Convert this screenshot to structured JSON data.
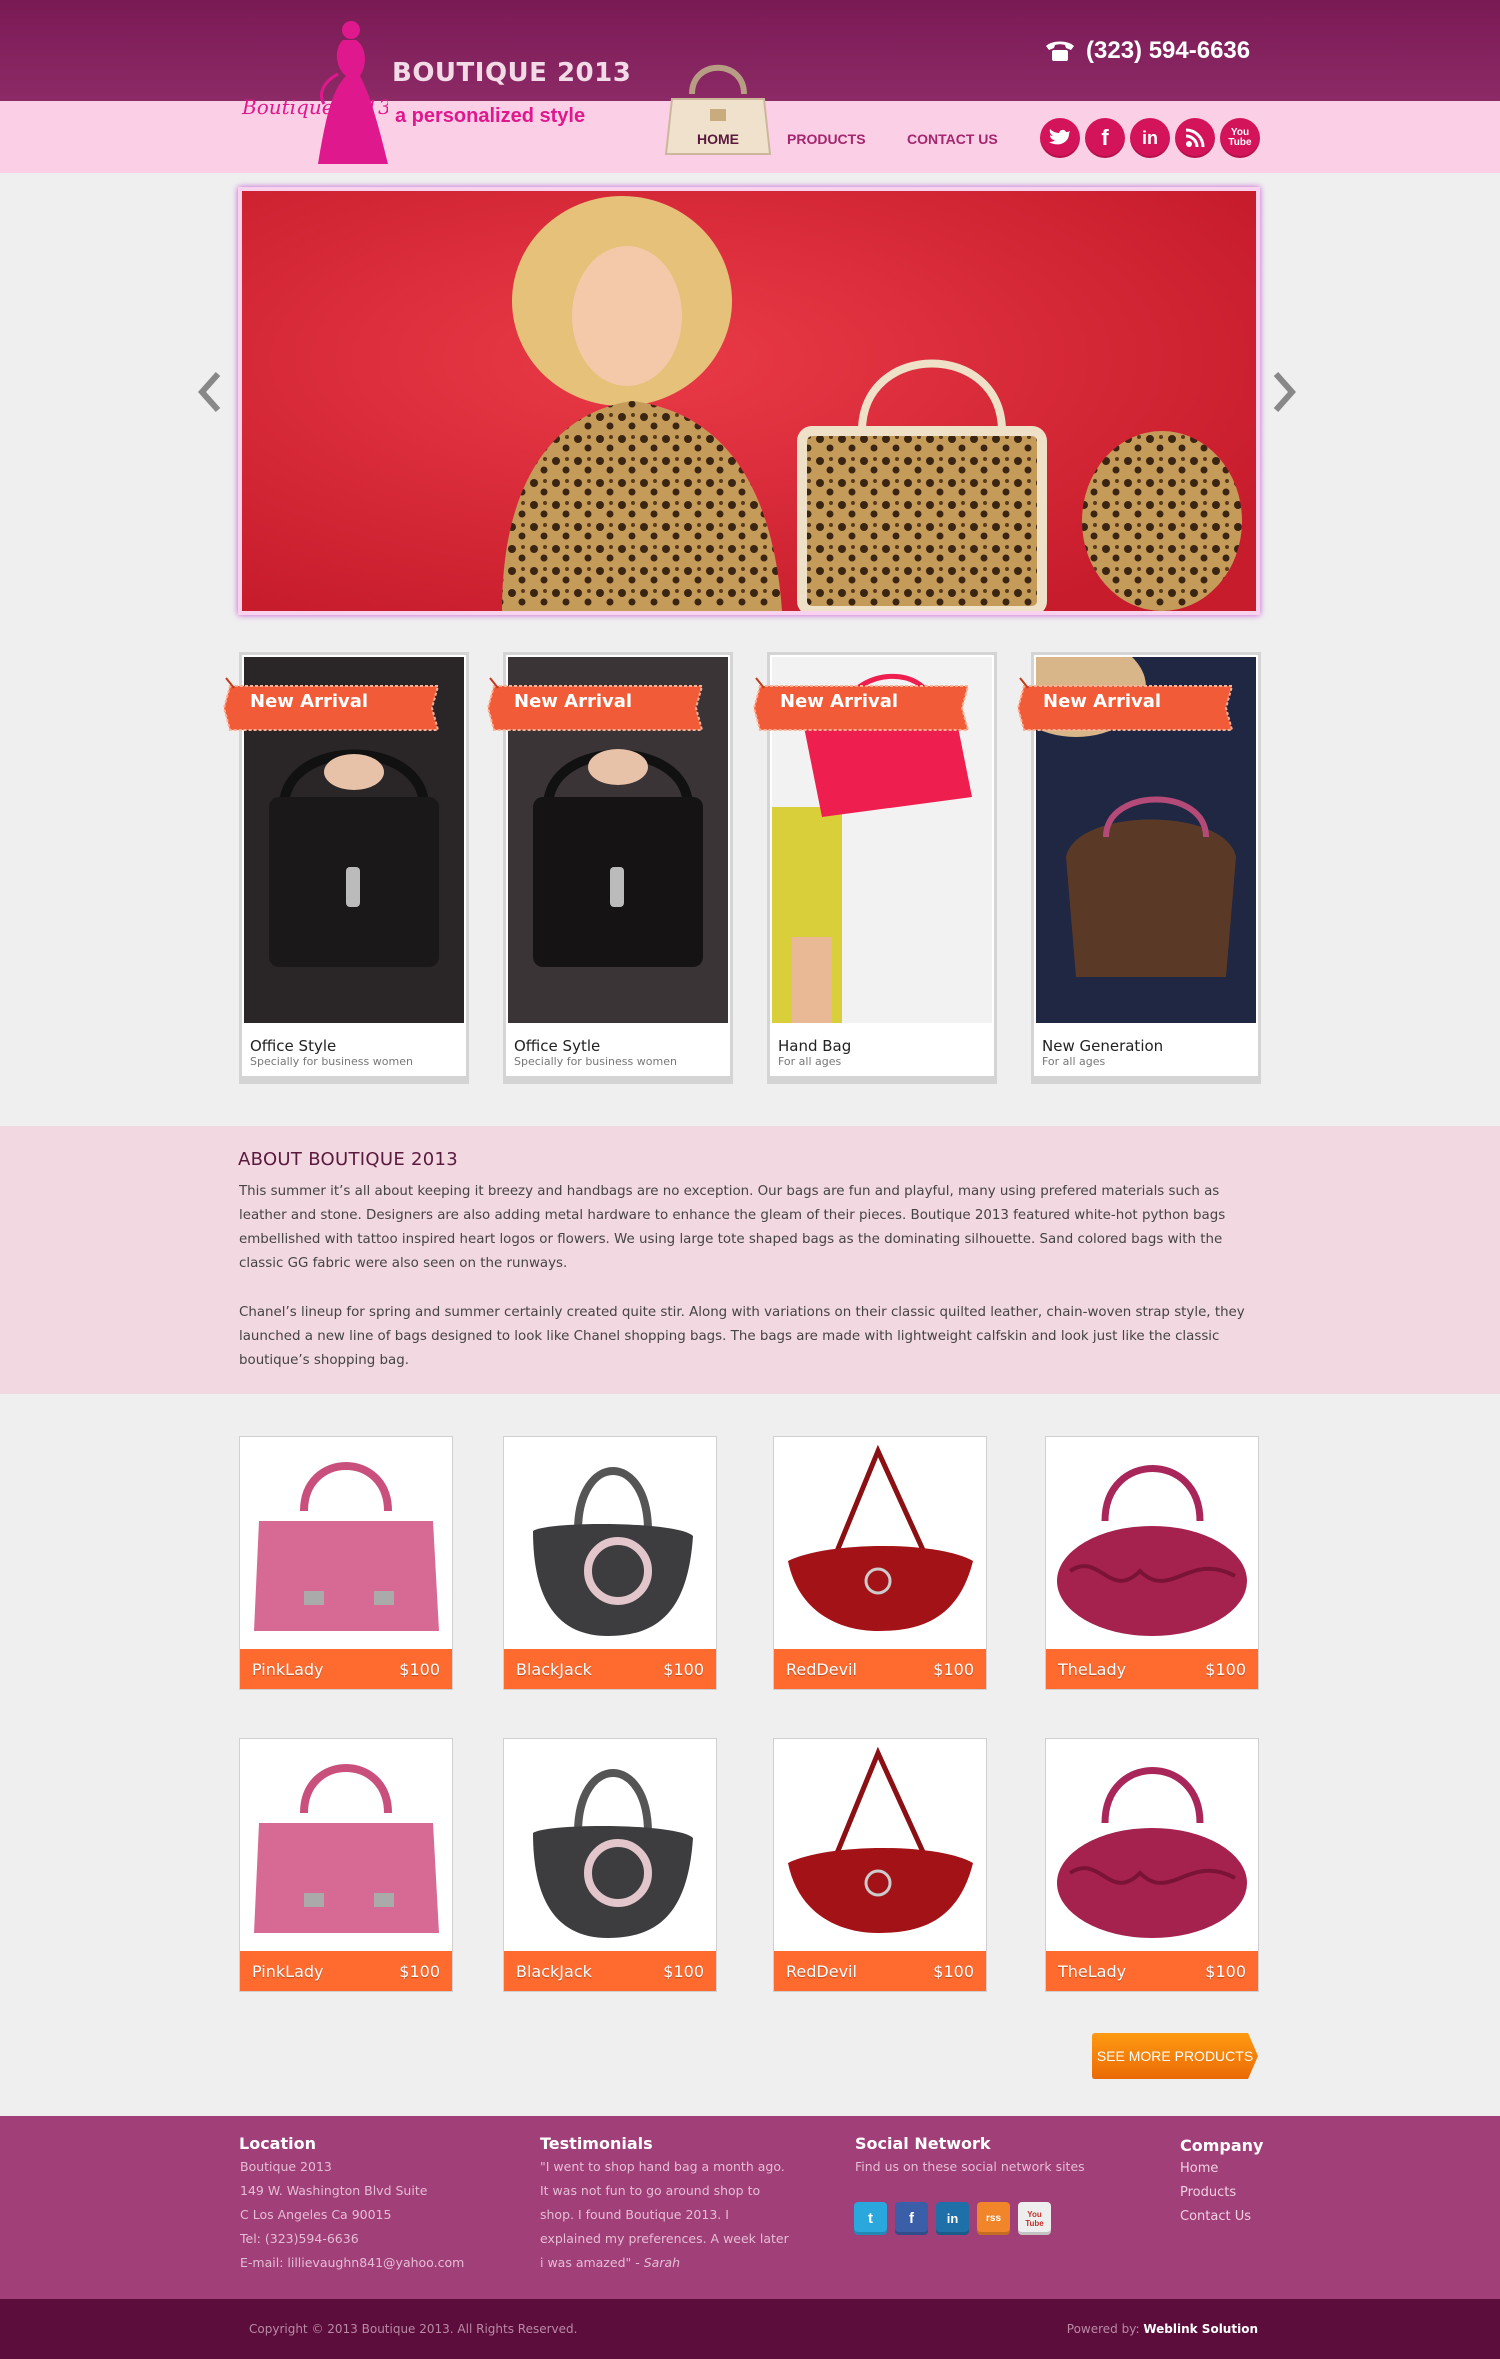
{
  "header": {
    "logo_text": "Boutique 2013",
    "title": "BOUTIQUE 2013",
    "tagline": "a personalized style",
    "phone": "(323) 594-6636",
    "nav": [
      "HOME",
      "PRODUCTS",
      "CONTACT US"
    ],
    "social": [
      "twitter",
      "facebook",
      "linkedin",
      "rss",
      "youtube"
    ],
    "social_labels": {
      "facebook": "f",
      "linkedin": "in",
      "youtube": "You Tube"
    }
  },
  "arrivals": {
    "tag": "New Arrival",
    "items": [
      {
        "name": "Office Style",
        "sub": "Specially for business women"
      },
      {
        "name": "Office Sytle",
        "sub": "Specially for business women"
      },
      {
        "name": "Hand Bag",
        "sub": "For all ages"
      },
      {
        "name": "New Generation",
        "sub": "For all ages"
      }
    ]
  },
  "about": {
    "title": "ABOUT BOUTIQUE 2013",
    "p1": "This summer it’s all about keeping it breezy and handbags are no exception. Our bags are fun and playful, many using prefered materials such as leather and stone. Designers are also adding metal hardware to enhance the gleam of their pieces. Boutique 2013 featured white-hot python bags embellished with tattoo inspired heart logos or flowers. We using large tote shaped bags as the dominating silhouette. Sand colored bags with the classic GG fabric were also seen on the runways.",
    "p2": "Chanel’s lineup for spring and summer certainly created quite stir. Along with variations on their classic quilted leather, chain-woven strap style, they launched a new line of bags designed to look like Chanel shopping bags. The bags are made with lightweight calfskin and look just like the classic boutique’s shopping bag."
  },
  "products": [
    {
      "name": "PinkLady",
      "price": "$100"
    },
    {
      "name": "BlackJack",
      "price": "$100"
    },
    {
      "name": "RedDevil",
      "price": "$100"
    },
    {
      "name": "TheLady",
      "price": "$100"
    },
    {
      "name": "PinkLady",
      "price": "$100"
    },
    {
      "name": "BlackJack",
      "price": "$100"
    },
    {
      "name": "RedDevil",
      "price": "$100"
    },
    {
      "name": "TheLady",
      "price": "$100"
    }
  ],
  "see_more": "SEE MORE PRODUCTS",
  "footer": {
    "location": {
      "title": "Location",
      "lines": [
        "Boutique 2013",
        "149 W. Washington Blvd Suite",
        "C Los Angeles Ca 90015",
        "Tel: (323)594-6636",
        "E-mail: lillievaughn841@yahoo.com"
      ]
    },
    "testimonials": {
      "title": "Testimonials",
      "quote": "\"I went to shop hand bag a month ago. It was not fun to go around shop to shop. I found Boutique 2013. I explained my preferences. A week later i was amazed\" - ",
      "author": "Sarah"
    },
    "social": {
      "title": "Social Network",
      "text": "Find us on these social network sites",
      "labels": [
        "t",
        "f",
        "in",
        "rss",
        "You Tube"
      ]
    },
    "company": {
      "title": "Company",
      "links": [
        "Home",
        "Products",
        "Contact Us"
      ]
    }
  },
  "copyright": "Copyright © 2013 Boutique 2013. All Rights Reserved.",
  "powered_label": "Powered by:",
  "powered_by": "Weblink Solution",
  "colors": {
    "header": "#7a1a55",
    "band": "#fbd0e6",
    "accent": "#ff6a2e",
    "footer": "#a03f78",
    "footer_bottom": "#5c0d3c"
  }
}
